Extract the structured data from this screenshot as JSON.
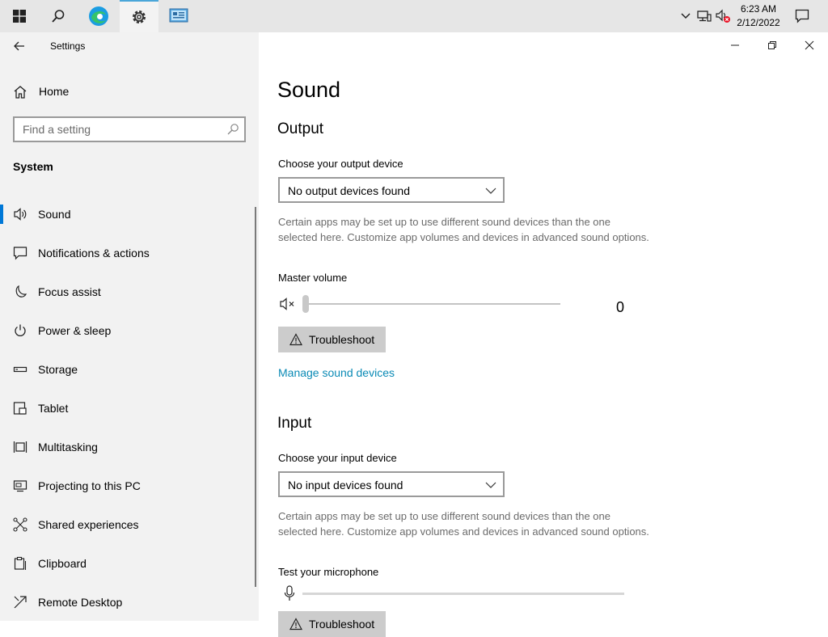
{
  "taskbar": {
    "clock_time": "6:23 AM",
    "clock_date": "2/12/2022"
  },
  "leftpane": {
    "app_title": "Settings",
    "home_label": "Home",
    "search_placeholder": "Find a setting",
    "section_title": "System",
    "items": [
      {
        "label": "Sound",
        "icon": "speaker-icon"
      },
      {
        "label": "Notifications & actions",
        "icon": "message-icon"
      },
      {
        "label": "Focus assist",
        "icon": "moon-icon"
      },
      {
        "label": "Power & sleep",
        "icon": "power-icon"
      },
      {
        "label": "Storage",
        "icon": "storage-icon"
      },
      {
        "label": "Tablet",
        "icon": "tablet-icon"
      },
      {
        "label": "Multitasking",
        "icon": "multitasking-icon"
      },
      {
        "label": "Projecting to this PC",
        "icon": "projector-icon"
      },
      {
        "label": "Shared experiences",
        "icon": "share-icon"
      },
      {
        "label": "Clipboard",
        "icon": "clipboard-icon"
      },
      {
        "label": "Remote Desktop",
        "icon": "remote-icon"
      }
    ]
  },
  "content": {
    "page_title": "Sound",
    "output": {
      "heading": "Output",
      "device_label": "Choose your output device",
      "device_value": "No output devices found",
      "description": "Certain apps may be set up to use different sound devices than the one selected here. Customize app volumes and devices in advanced sound options.",
      "volume_label": "Master volume",
      "volume_value": "0",
      "troubleshoot_label": "Troubleshoot",
      "manage_link": "Manage sound devices"
    },
    "input": {
      "heading": "Input",
      "device_label": "Choose your input device",
      "device_value": "No input devices found",
      "description": "Certain apps may be set up to use different sound devices than the one selected here. Customize app volumes and devices in advanced sound options.",
      "mic_label": "Test your microphone",
      "troubleshoot_label": "Troubleshoot"
    }
  },
  "colors": {
    "accent": "#0078d7",
    "link": "#0a8ab5",
    "taskbar": "#e6e6e6",
    "leftpane": "#f2f2f2"
  }
}
